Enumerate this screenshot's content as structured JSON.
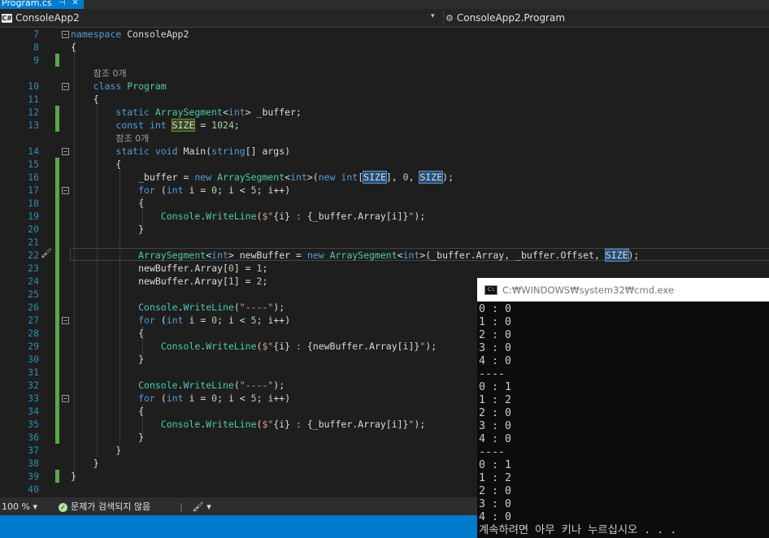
{
  "tab": {
    "title": "Program.cs",
    "pin": "⊣",
    "close": "✕"
  },
  "nav": {
    "project": "ConsoleApp2",
    "project_icon": "C#",
    "member": "ConsoleApp2.Program",
    "dropdown_arrow": "▾"
  },
  "code_lines": [
    {
      "n": "7",
      "html": "<span class=\"kw\">namespace</span> <span class=\"tx\">ConsoleApp2</span>"
    },
    {
      "n": "8",
      "html": "<span class=\"tx\">{</span>"
    },
    {
      "n": "9",
      "html": ""
    },
    {
      "n": "",
      "html": "    <span class=\"ref\">참조 0개</span>"
    },
    {
      "n": "10",
      "html": "    <span class=\"kw\">class</span> <span class=\"ty\">Program</span>"
    },
    {
      "n": "11",
      "html": "    <span class=\"tx\">{</span>"
    },
    {
      "n": "12",
      "html": "        <span class=\"kw\">static</span> <span class=\"ty\">ArraySegment</span><span class=\"tx\">&lt;</span><span class=\"kw\">int</span><span class=\"tx\">&gt; _buffer;</span>"
    },
    {
      "n": "13",
      "html": "        <span class=\"kw\">const</span> <span class=\"kw\">int</span> <span class=\"tx hl2\">SIZE</span> <span class=\"tx\">= </span><span class=\"nm\">1024</span><span class=\"tx\">;</span>"
    },
    {
      "n": "",
      "html": "        <span class=\"ref\">참조 0개</span>"
    },
    {
      "n": "14",
      "html": "        <span class=\"kw\">static</span> <span class=\"kw\">void</span> <span class=\"tx\">Main(</span><span class=\"kw\">string</span><span class=\"tx\">[] args)</span>"
    },
    {
      "n": "15",
      "html": "        <span class=\"tx\">{</span>"
    },
    {
      "n": "16",
      "html": "            <span class=\"tx\">_buffer = </span><span class=\"kw\">new</span> <span class=\"ty\">ArraySegment</span><span class=\"tx\">&lt;</span><span class=\"kw\">int</span><span class=\"tx\">&gt;(</span><span class=\"kw\">new</span> <span class=\"kw\">int</span><span class=\"tx\">[</span><span class=\"tx hl\">SIZE</span><span class=\"tx\">], </span><span class=\"nm\">0</span><span class=\"tx\">, </span><span class=\"tx hl\">SIZE</span><span class=\"tx\">);</span>"
    },
    {
      "n": "17",
      "html": "            <span class=\"kw\">for</span> <span class=\"tx\">(</span><span class=\"kw\">int</span> <span class=\"tx\">i = </span><span class=\"nm\">0</span><span class=\"tx\">; i &lt; </span><span class=\"nm\">5</span><span class=\"tx\">; i++)</span>"
    },
    {
      "n": "18",
      "html": "            <span class=\"tx\">{</span>"
    },
    {
      "n": "19",
      "html": "                <span class=\"ty\">Console</span><span class=\"tx\">.</span><span class=\"ty\">WriteLine</span><span class=\"tx\">(</span><span class=\"st\">$\"</span><span class=\"tx\">{i}</span><span class=\"st\"> : </span><span class=\"tx\">{_buffer.Array[i]}</span><span class=\"st\">\"</span><span class=\"tx\">);</span>"
    },
    {
      "n": "20",
      "html": "            <span class=\"tx\">}</span>"
    },
    {
      "n": "21",
      "html": ""
    },
    {
      "n": "22",
      "html": "            <span class=\"ty\">ArraySegment</span><span class=\"tx\">&lt;</span><span class=\"kw\">int</span><span class=\"tx\">&gt; newBuffer = </span><span class=\"kw\">new</span> <span class=\"ty\">ArraySegment</span><span class=\"tx\">&lt;</span><span class=\"kw\">int</span><span class=\"tx\">&gt;(_buffer.Array, _buffer.Offset, </span><span class=\"tx hl\">SIZE</span><span class=\"tx\">);</span>"
    },
    {
      "n": "23",
      "html": "            <span class=\"tx\">newBuffer.Array[</span><span class=\"nm\">0</span><span class=\"tx\">] = </span><span class=\"nm\">1</span><span class=\"tx\">;</span>"
    },
    {
      "n": "24",
      "html": "            <span class=\"tx\">newBuffer.Array[</span><span class=\"nm\">1</span><span class=\"tx\">] = </span><span class=\"nm\">2</span><span class=\"tx\">;</span>"
    },
    {
      "n": "25",
      "html": ""
    },
    {
      "n": "26",
      "html": "            <span class=\"ty\">Console</span><span class=\"tx\">.</span><span class=\"ty\">WriteLine</span><span class=\"tx\">(</span><span class=\"st\">\"----\"</span><span class=\"tx\">);</span>"
    },
    {
      "n": "27",
      "html": "            <span class=\"kw\">for</span> <span class=\"tx\">(</span><span class=\"kw\">int</span> <span class=\"tx\">i = </span><span class=\"nm\">0</span><span class=\"tx\">; i &lt; </span><span class=\"nm\">5</span><span class=\"tx\">; i++)</span>"
    },
    {
      "n": "28",
      "html": "            <span class=\"tx\">{</span>"
    },
    {
      "n": "29",
      "html": "                <span class=\"ty\">Console</span><span class=\"tx\">.</span><span class=\"ty\">WriteLine</span><span class=\"tx\">(</span><span class=\"st\">$\"</span><span class=\"tx\">{i}</span><span class=\"st\"> : </span><span class=\"tx\">{newBuffer.Array[i]}</span><span class=\"st\">\"</span><span class=\"tx\">);</span>"
    },
    {
      "n": "30",
      "html": "            <span class=\"tx\">}</span>"
    },
    {
      "n": "31",
      "html": ""
    },
    {
      "n": "32",
      "html": "            <span class=\"ty\">Console</span><span class=\"tx\">.</span><span class=\"ty\">WriteLine</span><span class=\"tx\">(</span><span class=\"st\">\"----\"</span><span class=\"tx\">);</span>"
    },
    {
      "n": "33",
      "html": "            <span class=\"kw\">for</span> <span class=\"tx\">(</span><span class=\"kw\">int</span> <span class=\"tx\">i = </span><span class=\"nm\">0</span><span class=\"tx\">; i &lt; </span><span class=\"nm\">5</span><span class=\"tx\">; i++)</span>"
    },
    {
      "n": "34",
      "html": "            <span class=\"tx\">{</span>"
    },
    {
      "n": "35",
      "html": "                <span class=\"ty\">Console</span><span class=\"tx\">.</span><span class=\"ty\">WriteLine</span><span class=\"tx\">(</span><span class=\"st\">$\"</span><span class=\"tx\">{i}</span><span class=\"st\"> : </span><span class=\"tx\">{_buffer.Array[i]}</span><span class=\"st\">\"</span><span class=\"tx\">);</span>"
    },
    {
      "n": "36",
      "html": "            <span class=\"tx\">}</span>"
    },
    {
      "n": "37",
      "html": "        <span class=\"tx\">}</span>"
    },
    {
      "n": "38",
      "html": "    <span class=\"tx\">}</span>"
    },
    {
      "n": "39",
      "html": "<span class=\"tx\">}</span>"
    },
    {
      "n": "40",
      "html": ""
    }
  ],
  "status": {
    "zoom": "100 %",
    "zoom_arrow": "▾",
    "issues": "문제가 검색되지 않음",
    "brush": "🖌",
    "brush_arrow": "▾"
  },
  "cmd": {
    "title": "C:₩WINDOWS₩system32₩cmd.exe",
    "icon": "C:\\",
    "lines": [
      "0 : 0",
      "1 : 0",
      "2 : 0",
      "3 : 0",
      "4 : 0",
      "----",
      "0 : 1",
      "1 : 2",
      "2 : 0",
      "3 : 0",
      "4 : 0",
      "----",
      "0 : 1",
      "1 : 2",
      "2 : 0",
      "3 : 0",
      "4 : 0",
      "계속하려면 아무 키나 누르십시오 . . ."
    ]
  },
  "colors": {
    "accent": "#007acc",
    "change_bar": "#57a64a",
    "line_number": "#2b91af",
    "keyword": "#569cd6",
    "type": "#4ec9b0",
    "string": "#d69d85"
  }
}
